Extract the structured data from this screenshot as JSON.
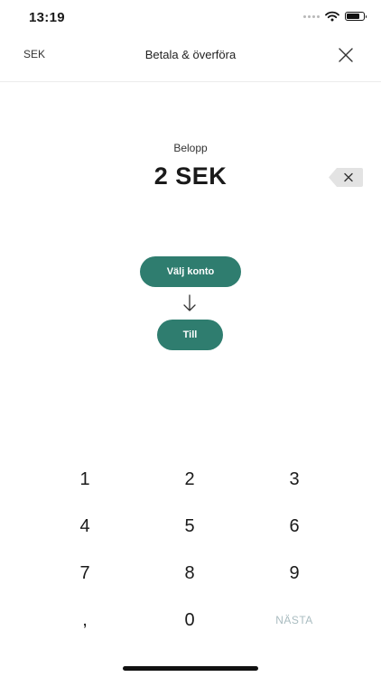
{
  "status": {
    "time": "13:19"
  },
  "header": {
    "currency": "SEK",
    "title": "Betala & överföra"
  },
  "amount": {
    "label": "Belopp",
    "value": "2 SEK"
  },
  "transfer": {
    "from_label": "Välj konto",
    "to_label": "Till"
  },
  "keypad": {
    "keys": [
      "1",
      "2",
      "3",
      "4",
      "5",
      "6",
      "7",
      "8",
      "9",
      ",",
      "0",
      "NÄSTA"
    ]
  },
  "colors": {
    "accent": "#2f7d6f",
    "next_disabled": "#a9bcc0"
  },
  "icons": {
    "close": "close-icon",
    "backspace": "backspace-icon",
    "arrow": "arrow-down-icon"
  }
}
